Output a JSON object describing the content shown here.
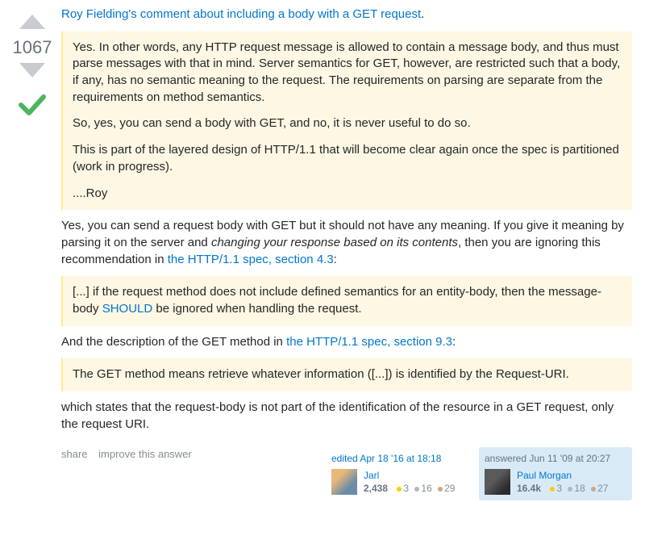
{
  "vote": {
    "count": "1067"
  },
  "intro_link": "Roy Fielding's comment about including a body with a GET request",
  "quote1": {
    "p1": "Yes. In other words, any HTTP request message is allowed to contain a message body, and thus must parse messages with that in mind. Server semantics for GET, however, are restricted such that a body, if any, has no semantic meaning to the request. The requirements on parsing are separate from the requirements on method semantics.",
    "p2": "So, yes, you can send a body with GET, and no, it is never useful to do so.",
    "p3": "This is part of the layered design of HTTP/1.1 that will become clear again once the spec is partitioned (work in progress).",
    "p4": "....Roy"
  },
  "para1": {
    "pre": "Yes, you can send a request body with GET but it should not have any meaning. If you give it meaning by parsing it on the server and ",
    "em": "changing your response based on its contents",
    "post": ", then you are ignoring this recommendation in ",
    "link": "the HTTP/1.1 spec, section 4.3",
    "tail": ":"
  },
  "quote2": {
    "pre": "[...] if the request method does not include defined semantics for an entity-body, then the message-body ",
    "should": "SHOULD",
    "post": " be ignored when handling the request."
  },
  "para2": {
    "pre": "And the description of the GET method in ",
    "link": "the HTTP/1.1 spec, section 9.3",
    "post": ":"
  },
  "quote3": "The GET method means retrieve whatever information ([...]) is identified by the Request-URI.",
  "para3": "which states that the request-body is not part of the identification of the resource in a GET request, only the request URI.",
  "actions": {
    "share": "share",
    "improve": "improve this answer"
  },
  "editor": {
    "time": "edited Apr 18 '16 at 18:18",
    "name": "Jarl",
    "rep": "2,438",
    "gold": "3",
    "silver": "16",
    "bronze": "29"
  },
  "author": {
    "time": "answered Jun 11 '09 at 20:27",
    "name": "Paul Morgan",
    "rep": "16.4k",
    "gold": "3",
    "silver": "18",
    "bronze": "27"
  }
}
